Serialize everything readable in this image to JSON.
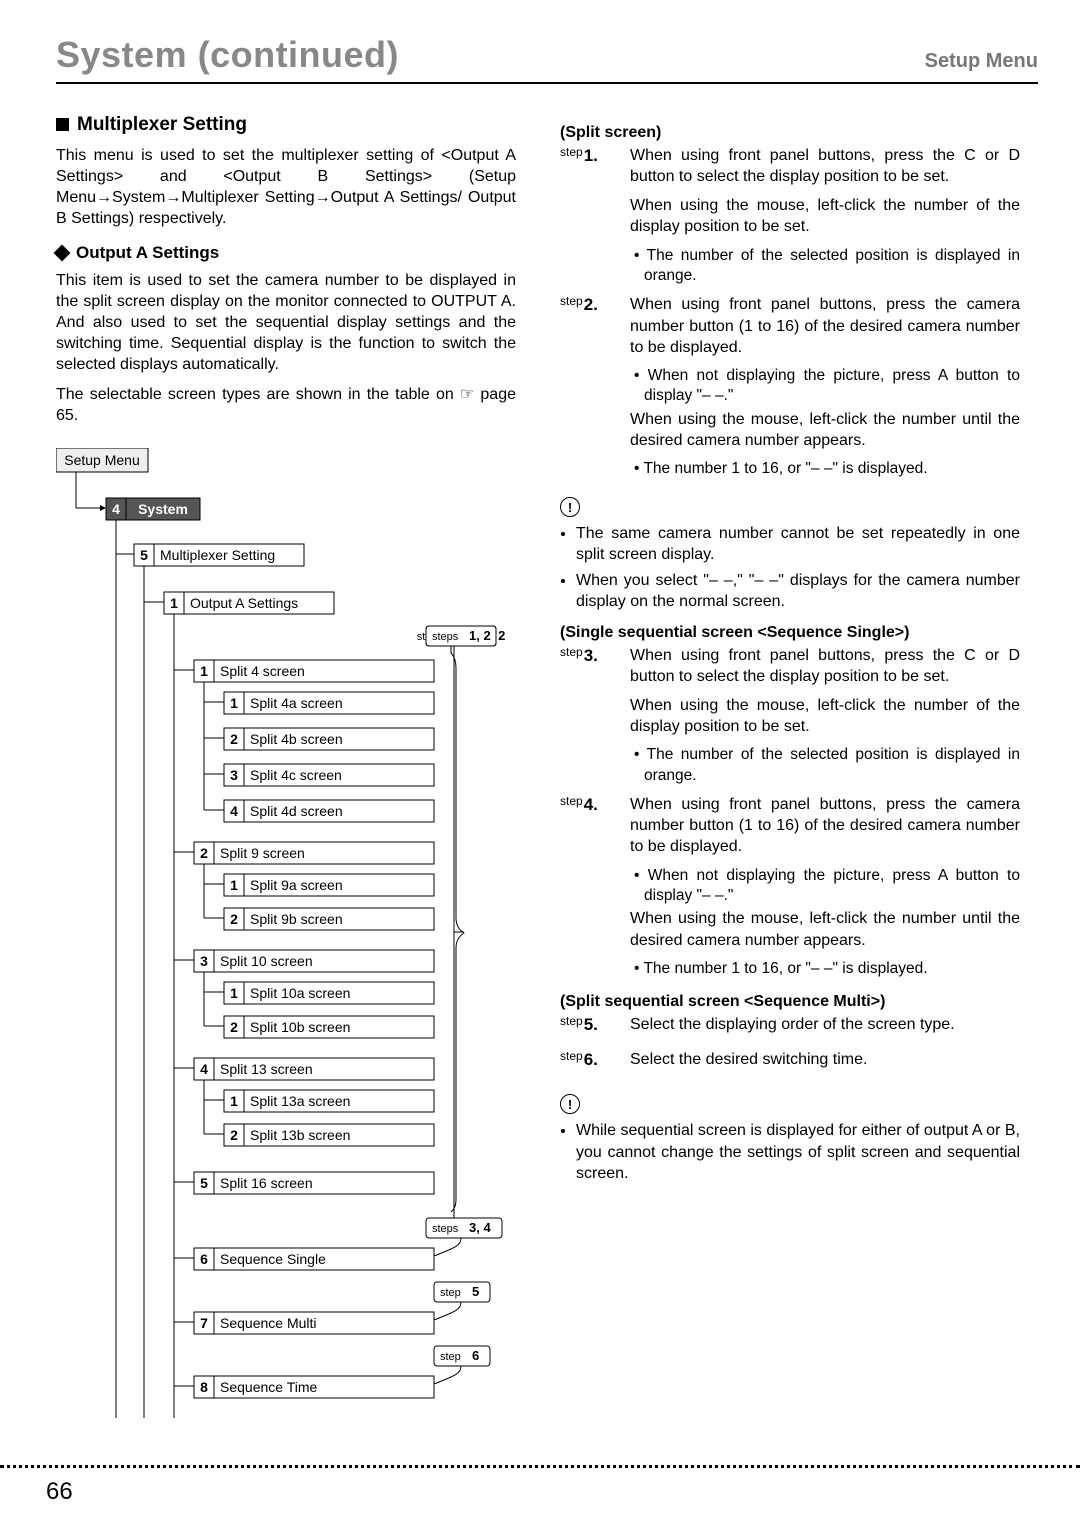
{
  "header": {
    "title": "System (continued)",
    "subtitle": "Setup Menu"
  },
  "left": {
    "h3": "Multiplexer Setting",
    "intro": "This menu is used to set the multiplexer setting of <Output A Settings> and <Output B Settings> (Setup Menu→System→Multiplexer Setting→Output A Settings/ Output B Settings) respectively.",
    "sub": "Output A Settings",
    "p2": "This item is used to set the camera number to be displayed in the split screen display on the monitor connected to OUTPUT A. And also used to set the sequential display settings and the switching time. Sequential display is the function to switch the selected displays automatically.",
    "p3a": "The selectable screen types are shown in the table on ",
    "p3b": " page 65.",
    "tree": {
      "setup": "Setup Menu",
      "sysnum": "4",
      "system": "System",
      "mulnum": "5",
      "mul": "Multiplexer Setting",
      "outnum": "1",
      "out": "Output A Settings",
      "steps12": "steps 1, 2",
      "items": [
        {
          "n": "1",
          "t": "Split 4 screen",
          "children": [
            {
              "n": "1",
              "t": "Split 4a screen"
            },
            {
              "n": "2",
              "t": "Split 4b screen"
            },
            {
              "n": "3",
              "t": "Split 4c screen"
            },
            {
              "n": "4",
              "t": "Split 4d screen"
            }
          ]
        },
        {
          "n": "2",
          "t": "Split 9 screen",
          "children": [
            {
              "n": "1",
              "t": "Split 9a screen"
            },
            {
              "n": "2",
              "t": "Split 9b screen"
            }
          ]
        },
        {
          "n": "3",
          "t": "Split 10 screen",
          "children": [
            {
              "n": "1",
              "t": "Split 10a screen"
            },
            {
              "n": "2",
              "t": "Split 10b screen"
            }
          ]
        },
        {
          "n": "4",
          "t": "Split 13 screen",
          "children": [
            {
              "n": "1",
              "t": "Split 13a screen"
            },
            {
              "n": "2",
              "t": "Split 13b screen"
            }
          ]
        },
        {
          "n": "5",
          "t": "Split 16 screen",
          "children": []
        },
        {
          "n": "6",
          "t": "Sequence Single",
          "children": [],
          "step": "steps 3, 4"
        },
        {
          "n": "7",
          "t": "Sequence Multi",
          "children": [],
          "step": "step 5"
        },
        {
          "n": "8",
          "t": "Sequence Time",
          "children": [],
          "step": "step 6"
        }
      ]
    }
  },
  "right": {
    "split_h": "(Split screen)",
    "s1": {
      "label": "step1.",
      "t": "When using front panel buttons, press the C or D button to select the display position to be set.",
      "t2": "When using the mouse, left-click the number of the display position to be set.",
      "b1": "• The number of the selected position is displayed in orange."
    },
    "s2": {
      "label": "step2.",
      "t": "When using front panel buttons, press the camera number button (1 to 16) of the desired camera number to be displayed.",
      "b1": "• When not displaying the picture, press A button to display \"– –.\"",
      "t2": "When using the mouse, left-click the number until the desired camera number appears.",
      "b2": "• The number 1 to 16, or \"– –\" is displayed."
    },
    "warn1a": "The same camera number cannot be set repeatedly in one split screen display.",
    "warn1b": "When you select \"– –,\" \"– –\" displays for the camera number display on the normal screen.",
    "single_h": "(Single sequential screen <Sequence Single>)",
    "s3": {
      "label": "step3.",
      "t": "When using front panel buttons, press the C or D button to select the display position to be set.",
      "t2": "When using the mouse, left-click the number of the display position to be set.",
      "b1": "• The number of the selected position is displayed in orange."
    },
    "s4": {
      "label": "step4.",
      "t": "When using front panel buttons, press the camera number button (1 to 16) of the desired camera number to be displayed.",
      "b1": "• When not displaying the picture, press A button to display \"– –.\"",
      "t2": "When using the mouse, left-click the number until the desired camera number appears.",
      "b2": "• The number 1 to 16, or \"– –\" is displayed."
    },
    "multi_h": "(Split sequential screen <Sequence Multi>)",
    "s5": {
      "label": "step5.",
      "t": "Select the displaying order of the screen type."
    },
    "s6": {
      "label": "step6.",
      "t": "Select the desired switching time."
    },
    "warn2": "While sequential screen is displayed for either of output A or B, you cannot change the settings of split screen and sequential screen."
  },
  "pagenum": "66"
}
